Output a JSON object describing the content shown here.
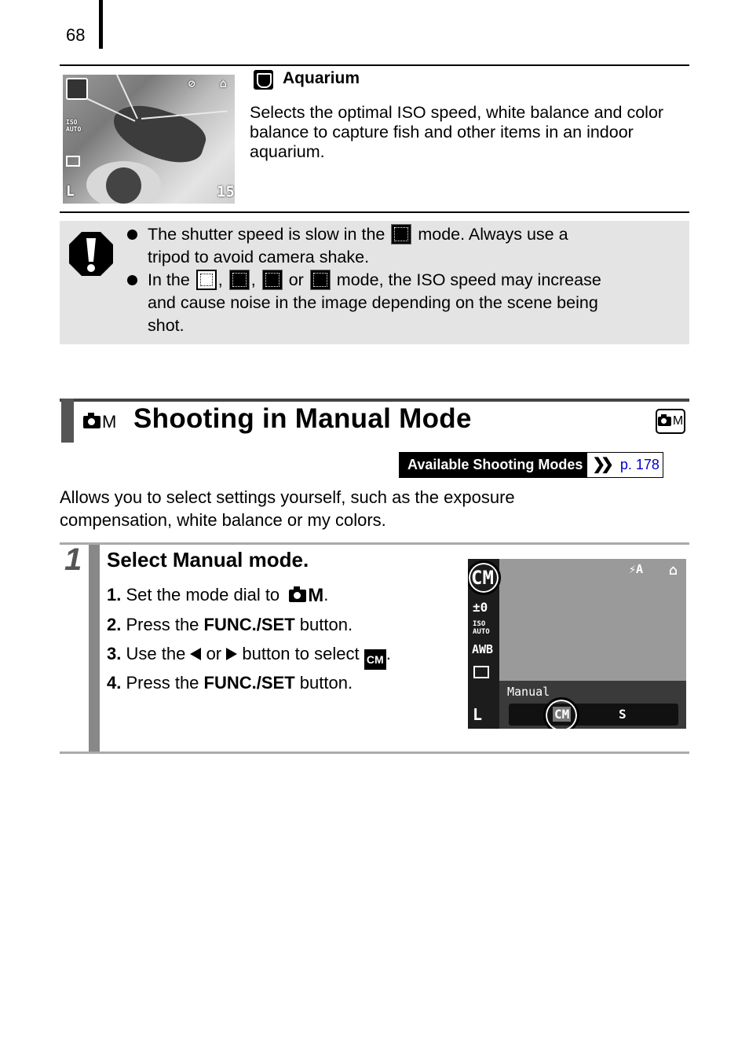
{
  "page": {
    "number": "68"
  },
  "aquarium": {
    "title": "Aquarium",
    "icon": "aquarium-mode-icon",
    "description": "Selects the optimal ISO speed, white balance and color balance to capture fish and other items in an indoor aquarium.",
    "photo": {
      "iso_label_top": "ISO",
      "iso_label_bottom": "AUTO",
      "shots_remaining": "15",
      "size_label": "L"
    }
  },
  "caution": {
    "icon": "caution-exclamation-icon",
    "item1_a": "The shutter speed is slow in the",
    "item1_icon": "fireworks-mode-icon",
    "item1_b": "mode. Always use a",
    "item1_c": "tripod to avoid camera shake.",
    "item2_a": "In the",
    "item2_icons": [
      "night-snapshot-icon",
      "kids-pets-icon",
      "indoor-party-icon",
      "aquarium-icon"
    ],
    "sep1": ",",
    "sep2": ",",
    "or": "or",
    "item2_b": "mode, the ISO speed may increase",
    "item2_c": "and cause noise in the image depending on the scene being",
    "item2_d": "shot."
  },
  "section": {
    "mode_letter": "M",
    "title": "Shooting in Manual Mode",
    "available_label": "Available Shooting Modes",
    "available_link": "p. 178",
    "intro_line1": "Allows you to select settings yourself, such as the exposure",
    "intro_line2": "compensation, white balance or my colors."
  },
  "step": {
    "number": "1",
    "title": "Select Manual mode.",
    "lines": [
      {
        "num": "1.",
        "text": "Set the mode dial to",
        "tail": "."
      },
      {
        "num": "2.",
        "pre": "Press the",
        "bold": "FUNC./SET",
        "post": "button."
      },
      {
        "num": "3.",
        "pre": "Use the",
        "or": "or",
        "post": "button to select",
        "tail": "."
      },
      {
        "num": "4.",
        "pre": "Press the",
        "bold": "FUNC./SET",
        "post": "button."
      }
    ],
    "cm_label": "CM",
    "lcd": {
      "mode_label": "Manual",
      "exposure": "±0",
      "iso_top": "ISO",
      "iso_bottom": "AUTO",
      "wb": "AWB",
      "flash": "⚡A",
      "size": "L",
      "selected_mode": "CM",
      "other_mode": "S"
    }
  }
}
